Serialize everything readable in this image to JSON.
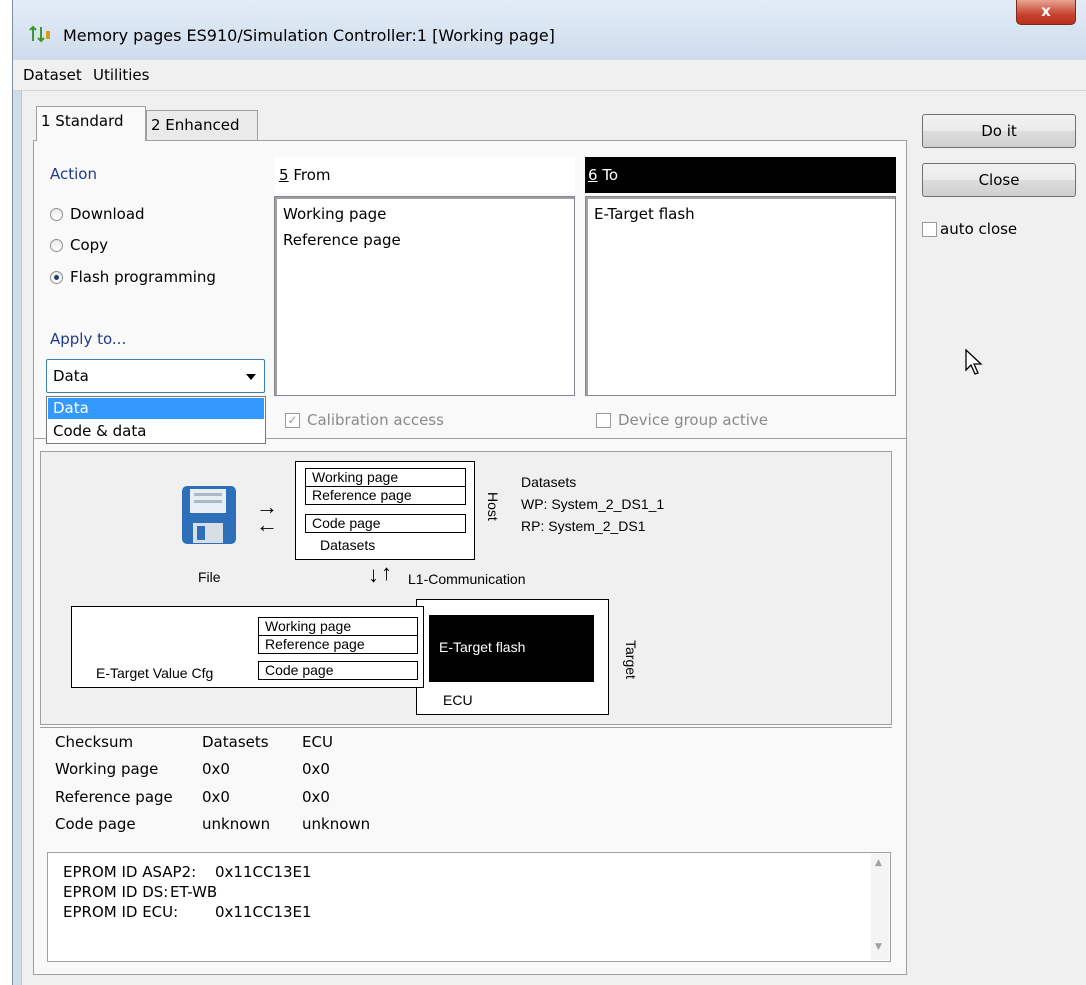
{
  "window": {
    "title": "Memory pages ES910/Simulation Controller:1 [Working page]",
    "close_glyph": "x"
  },
  "menu": [
    "Dataset",
    "Utilities"
  ],
  "tabs": [
    {
      "label": "1 Standard",
      "active": true
    },
    {
      "label": "2 Enhanced",
      "active": false
    }
  ],
  "action": {
    "label": "Action",
    "options": [
      {
        "label": "Download",
        "checked": false
      },
      {
        "label": "Copy",
        "checked": false
      },
      {
        "label": "Flash programming",
        "checked": true
      }
    ]
  },
  "apply_to": {
    "label": "Apply to...",
    "selected": "Data",
    "options": [
      "Data",
      "Code & data"
    ]
  },
  "from": {
    "label_key": "5",
    "label_rest": " From",
    "items": [
      "Working page",
      "Reference page"
    ]
  },
  "to": {
    "label_key": "6",
    "label_rest": " To",
    "items": [
      "E-Target flash"
    ]
  },
  "calibration_access": {
    "label": "Calibration access",
    "checked": true,
    "check_glyph": "✓"
  },
  "device_group_active": {
    "label": "Device group active",
    "checked": false
  },
  "buttons": {
    "do_it": "Do it",
    "close": "Close"
  },
  "auto_close": {
    "label": "auto close",
    "checked": false
  },
  "diagram": {
    "host_pages": [
      "Working page",
      "Reference page",
      "Code page"
    ],
    "host_datasets_label": "Datasets",
    "host_label": "Host",
    "datasets_title": "Datasets",
    "wp": "WP: System_2_DS1_1",
    "rp": "RP: System_2_DS1",
    "file_label": "File",
    "l1": "L1-Communication",
    "swap_arrow_right": "→",
    "swap_arrow_left": "←",
    "down_arrow": "↓",
    "up_arrow": "↑",
    "target_pages": [
      "Working page",
      "Reference page",
      "Code page"
    ],
    "value_cfg": "E-Target Value Cfg",
    "flash": "E-Target flash",
    "ecu": "ECU",
    "target_label": "Target"
  },
  "checksum": {
    "headers": [
      "Checksum",
      "Datasets",
      "ECU"
    ],
    "rows": [
      [
        "Working page",
        "0x0",
        "0x0"
      ],
      [
        "Reference page",
        "0x0",
        "0x0"
      ],
      [
        "Code page",
        "unknown",
        "unknown"
      ]
    ]
  },
  "eprom": [
    {
      "label": "EPROM ID ASAP2:",
      "value": "0x11CC13E1"
    },
    {
      "label": "EPROM ID DS:",
      "value": "ET-WB"
    },
    {
      "label": "EPROM ID ECU:",
      "value": "0x11CC13E1"
    }
  ],
  "scroll": {
    "up": "▲",
    "down": "▼"
  }
}
